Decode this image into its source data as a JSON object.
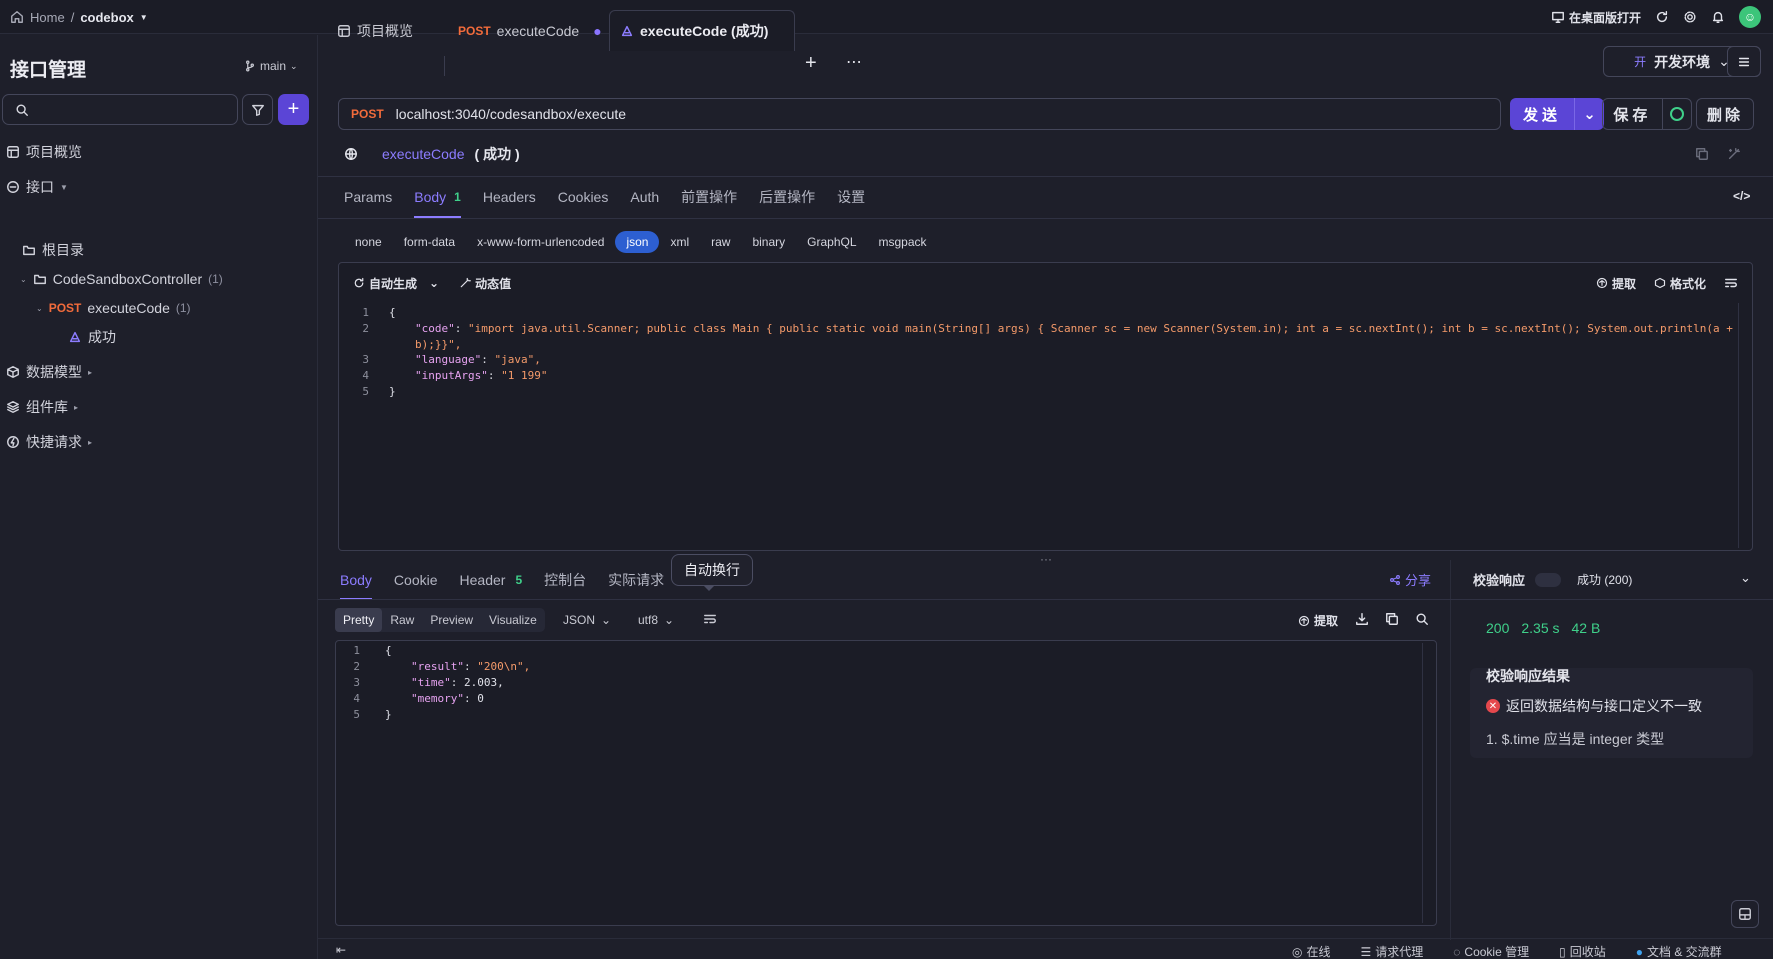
{
  "topbar": {
    "home": "Home",
    "separator": "/",
    "project": "codebox",
    "open_desktop": "在桌面版打开"
  },
  "sidebar": {
    "title": "接口管理",
    "branch": "main",
    "search_value": "",
    "items": {
      "overview": "项目概览",
      "api": "接口",
      "root": "根目录",
      "controller": "CodeSandboxController",
      "controller_count": "(1)",
      "method": "POST",
      "endpoint": "executeCode",
      "endpoint_count": "(1)",
      "case": "成功",
      "models": "数据模型",
      "components": "组件库",
      "quick": "快捷请求"
    }
  },
  "tabs": {
    "overview": "项目概览",
    "post_method": "POST",
    "post_name": "executeCode",
    "active": "executeCode (成功)",
    "env": "开发环境",
    "env_badge": "开"
  },
  "request": {
    "method": "POST",
    "url": "localhost:3040/codesandbox/execute",
    "send": "发送",
    "save": "保存",
    "delete": "删除",
    "name": "executeCode",
    "name_suffix": "( 成功 )",
    "subtabs": [
      "Params",
      "Body",
      "Headers",
      "Cookies",
      "Auth",
      "前置操作",
      "后置操作",
      "设置"
    ],
    "body_count": "1",
    "body_types": [
      "none",
      "form-data",
      "x-www-form-urlencoded",
      "json",
      "xml",
      "raw",
      "binary",
      "GraphQL",
      "msgpack"
    ],
    "body_type_selected": "json",
    "auto_generate": "自动生成",
    "dynamic_value": "动态值",
    "extract": "提取",
    "format": "格式化",
    "code_lines": {
      "l1": "{",
      "l2_key": "\"code\"",
      "l2_val": "\"import java.util.Scanner; public class Main { public static void main(String[] args) { Scanner sc = new Scanner(System.in); int a = sc.nextInt(); int b = sc.nextInt(); System.out.println(a +",
      "l2b": "b);}}\",",
      "l3_key": "\"language\"",
      "l3_val": "\"java\",",
      "l4_key": "\"inputArgs\"",
      "l4_val": "\"1 199\"",
      "l5": "}"
    }
  },
  "response": {
    "tabs": [
      "Body",
      "Cookie",
      "Header",
      "控制台",
      "实际请求"
    ],
    "header_count": "5",
    "tooltip": "自动换行",
    "share": "分享",
    "formats": [
      "Pretty",
      "Raw",
      "Preview",
      "Visualize"
    ],
    "lang": "JSON",
    "encoding": "utf8",
    "extract": "提取",
    "lines": {
      "l1": "{",
      "l2_key": "\"result\"",
      "l2_val": "\"200\\n\",",
      "l3_key": "\"time\"",
      "l3_val": "2.003,",
      "l4_key": "\"memory\"",
      "l4_val": "0",
      "l5": "}"
    }
  },
  "validation": {
    "label": "校验响应",
    "status": "成功 (200)",
    "code": "200",
    "duration": "2.35 s",
    "size": "42 B",
    "result_title": "校验响应结果",
    "error": "返回数据结构与接口定义不一致",
    "detail": "1. $.time 应当是 integer 类型"
  },
  "statusbar": {
    "online": "在线",
    "proxy": "请求代理",
    "cookie": "Cookie 管理",
    "recycle": "回收站",
    "docs": "文档 & 交流群"
  }
}
